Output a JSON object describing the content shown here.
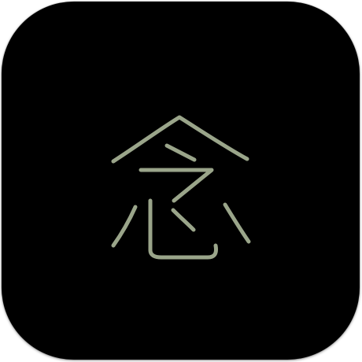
{
  "app_icon": {
    "glyph": "念",
    "background_color": "#000000",
    "glyph_color": "#9aa58a"
  }
}
